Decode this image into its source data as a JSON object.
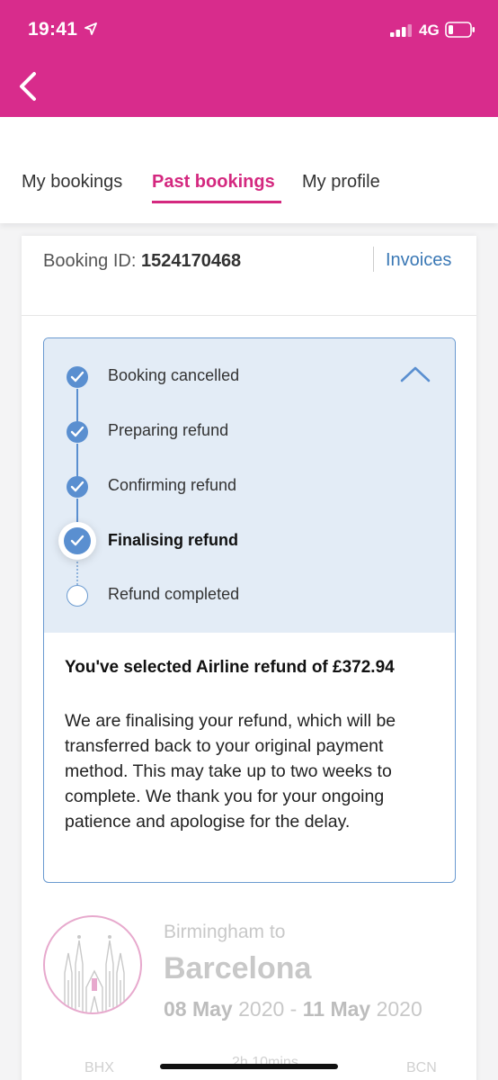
{
  "status_bar": {
    "time": "19:41",
    "network": "4G",
    "background_color": "#d82c8c"
  },
  "nav": {
    "back_icon": "chevron-left-icon"
  },
  "tabs": [
    {
      "label": "My bookings",
      "active": false
    },
    {
      "label": "Past bookings",
      "active": true
    },
    {
      "label": "My profile",
      "active": false
    }
  ],
  "accent_color": "#d4287f",
  "booking": {
    "id_label": "Booking ID:",
    "id_value": "1524170468",
    "invoices_label": "Invoices"
  },
  "refund_status": {
    "expanded": true,
    "steps": [
      {
        "label": "Booking cancelled",
        "state": "done"
      },
      {
        "label": "Preparing refund",
        "state": "done"
      },
      {
        "label": "Confirming refund",
        "state": "done"
      },
      {
        "label": "Finalising refund",
        "state": "current"
      },
      {
        "label": "Refund completed",
        "state": "pending"
      }
    ],
    "message_title": "You've selected Airline refund of £372.94",
    "message_body": "We are finalising your refund, which will be transferred back to your original payment method. This may take up to two weeks to complete. We thank you for your ongoing patience and apologise for the delay."
  },
  "trip": {
    "from": "Birmingham to",
    "to": "Barcelona",
    "date_start": "08 May",
    "year_start": "2020",
    "separator": "-",
    "date_end": "11 May",
    "year_end": "2020",
    "origin_code": "BHX",
    "duration": "2h 10mins",
    "destination_code": "BCN"
  }
}
